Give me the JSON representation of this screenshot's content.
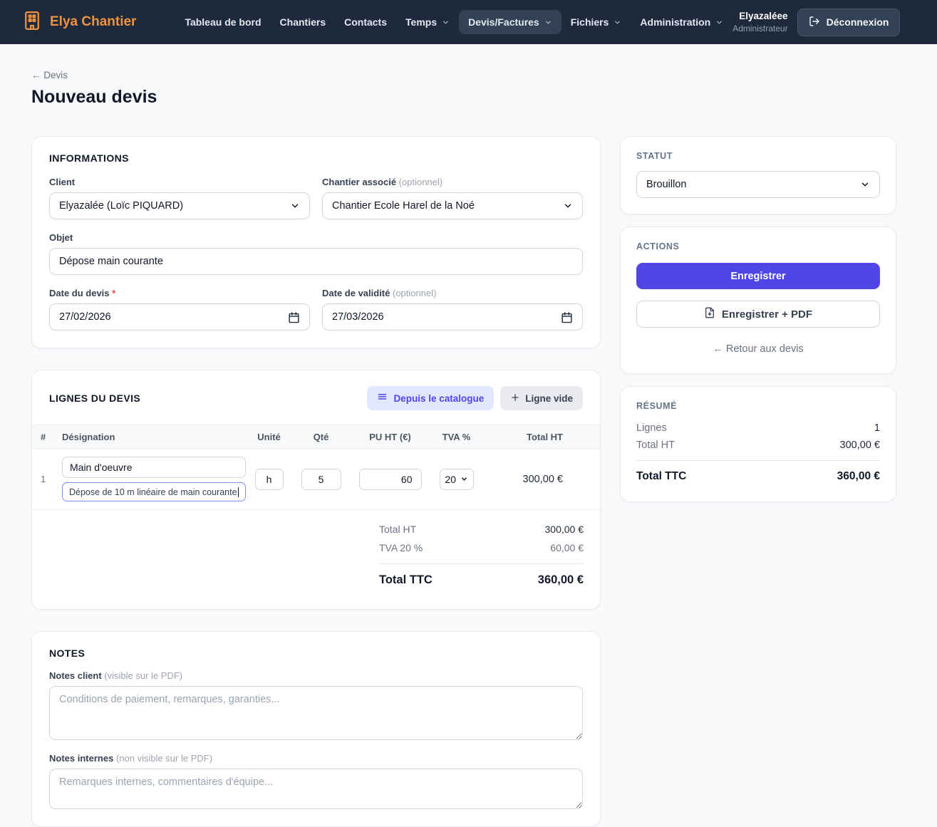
{
  "colors": {
    "navbar_bg": "#1e293b",
    "brand_orange": "#f0923f",
    "accent_indigo": "#4f46e5",
    "catalog_button_bg": "#e0e7ff",
    "required_red": "#ef4444",
    "focused_input_border": "#7e8bf7"
  },
  "icons": {
    "brand": "building-icon",
    "nav_dropdown": "chevron-down-icon",
    "logout": "log-out-icon",
    "catalog": "list-icon",
    "empty_line": "plus-icon",
    "save_pdf": "file-down-icon",
    "date": "calendar-icon",
    "select": "chevron-down-icon"
  },
  "navbar": {
    "brand": "Elya Chantier",
    "items": [
      {
        "label": "Tableau de bord",
        "dropdown": false,
        "active": false
      },
      {
        "label": "Chantiers",
        "dropdown": false,
        "active": false
      },
      {
        "label": "Contacts",
        "dropdown": false,
        "active": false
      },
      {
        "label": "Temps",
        "dropdown": true,
        "active": false
      },
      {
        "label": "Devis/Factures",
        "dropdown": true,
        "active": true
      },
      {
        "label": "Fichiers",
        "dropdown": true,
        "active": false
      },
      {
        "label": "Administration",
        "dropdown": true,
        "active": false
      }
    ],
    "user": {
      "name": "Elyazaléee",
      "role": "Administrateur"
    },
    "logout_label": "Déconnexion"
  },
  "page": {
    "breadcrumb": "← Devis",
    "title": "Nouveau devis"
  },
  "informations": {
    "heading": "INFORMATIONS",
    "client": {
      "label": "Client",
      "value": "Elyazalée (Loïc PIQUARD)"
    },
    "chantier": {
      "label": "Chantier associé",
      "hint": "(optionnel)",
      "value": "Chantier Ecole Harel de la Noé"
    },
    "objet": {
      "label": "Objet",
      "value": "Dépose main courante"
    },
    "date_devis": {
      "label": "Date du devis",
      "required": "*",
      "value": "27/02/2026"
    },
    "date_validite": {
      "label": "Date de validité",
      "hint": "(optionnel)",
      "value": "27/03/2026"
    }
  },
  "lignes": {
    "heading": "LIGNES DU DEVIS",
    "catalog_button": "Depuis le catalogue",
    "empty_line_button": "Ligne vide",
    "columns": [
      "#",
      "Désignation",
      "Unité",
      "Qté",
      "PU HT (€)",
      "TVA %",
      "Total HT"
    ],
    "rows": [
      {
        "num": "1",
        "designation": "Main d'oeuvre",
        "description": "Dépose de 10 m linéaire de main courante",
        "unite": "h",
        "qte": "5",
        "pu_ht": "60",
        "tva": "20",
        "total_ht": "300,00 €"
      }
    ],
    "totals": {
      "total_ht_label": "Total HT",
      "total_ht": "300,00 €",
      "tva_label": "TVA 20 %",
      "tva": "60,00 €",
      "total_ttc_label": "Total TTC",
      "total_ttc": "360,00 €"
    }
  },
  "statut": {
    "heading": "STATUT",
    "value": "Brouillon"
  },
  "actions": {
    "heading": "ACTIONS",
    "save_label": "Enregistrer",
    "save_pdf_label": "Enregistrer + PDF",
    "back_label": "← Retour aux devis"
  },
  "resume": {
    "heading": "RÉSUMÉ",
    "lignes_label": "Lignes",
    "lignes_value": "1",
    "total_ht_label": "Total HT",
    "total_ht": "300,00 €",
    "total_ttc_label": "Total TTC",
    "total_ttc": "360,00 €"
  },
  "notes": {
    "heading": "NOTES",
    "client_label": "Notes client",
    "client_hint": "(visible sur le PDF)",
    "client_placeholder": "Conditions de paiement, remarques, garanties...",
    "internes_label": "Notes internes",
    "internes_hint": "(non visible sur le PDF)",
    "internes_placeholder": "Remarques internes, commentaires d'équipe..."
  }
}
